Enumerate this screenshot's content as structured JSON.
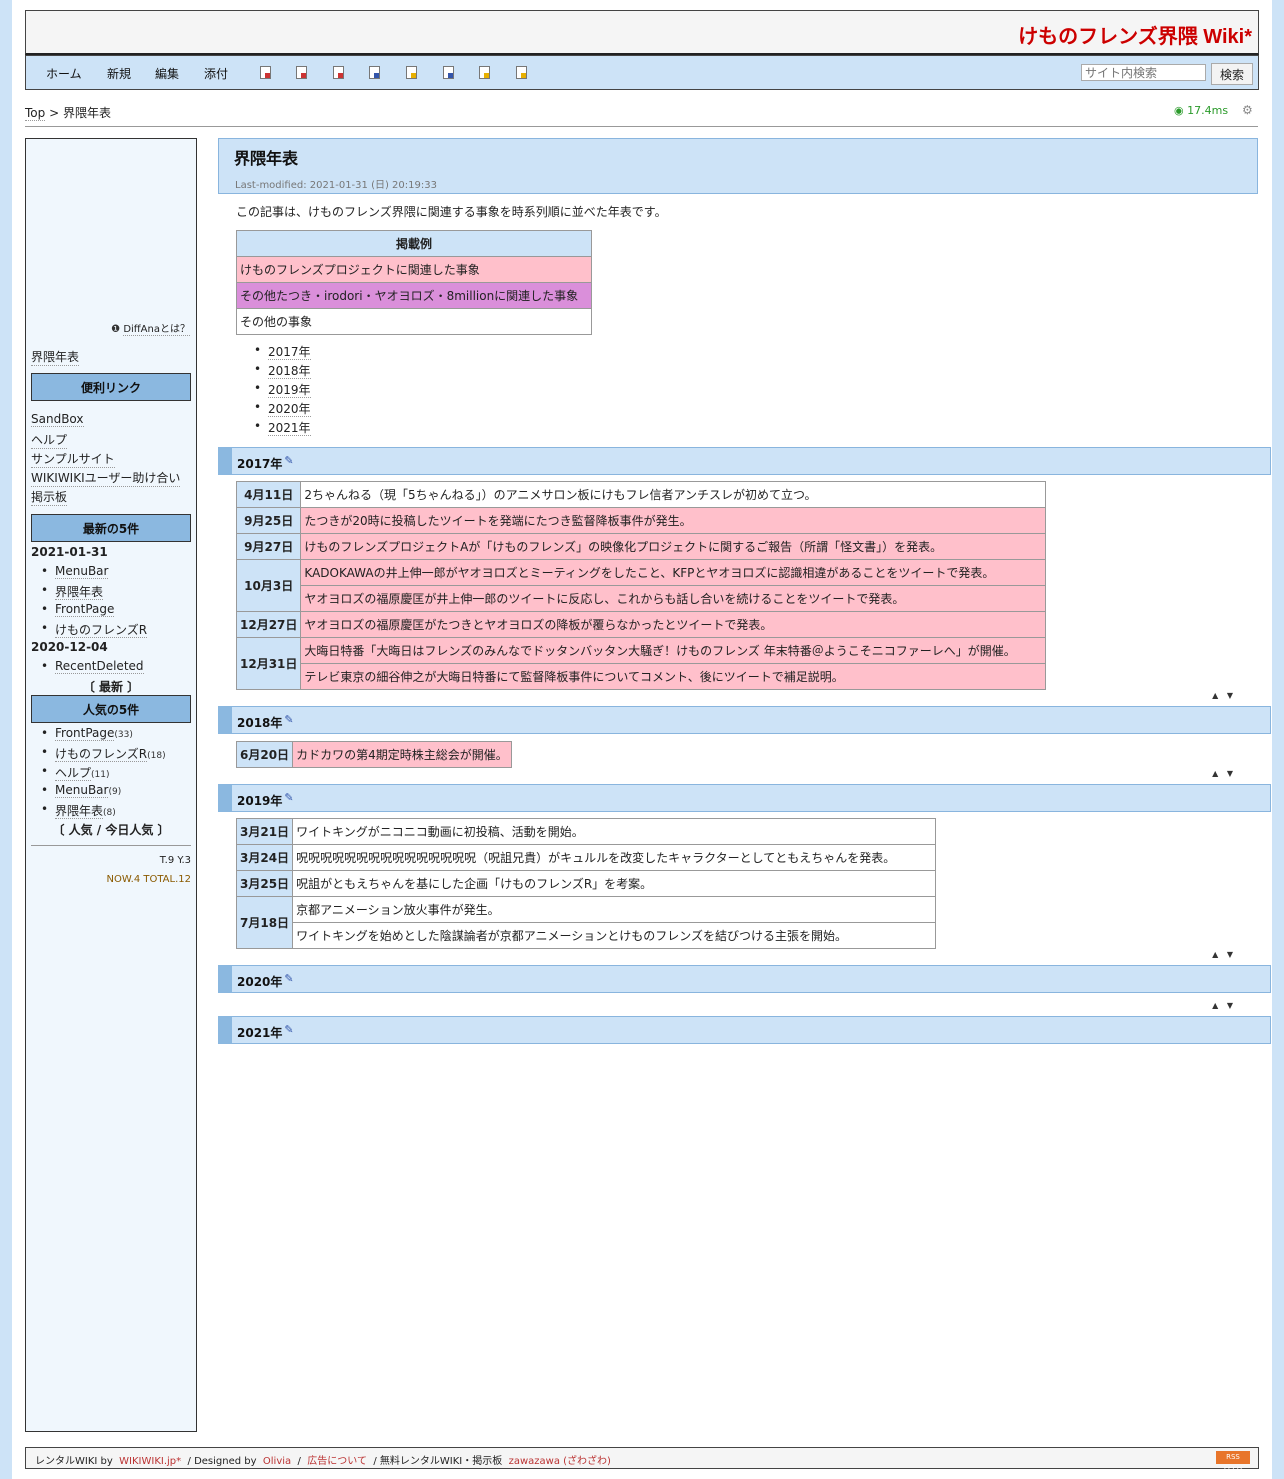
{
  "header": {
    "site_title": "けものフレンズ界隈 Wiki*"
  },
  "nav": {
    "items": [
      "ホーム",
      "新規",
      "編集",
      "添付"
    ],
    "search_placeholder": "サイト内検索",
    "search_button": "検索"
  },
  "breadcrumb": {
    "top": "Top",
    "sep": ">",
    "current": "界隈年表"
  },
  "timing": "17.4ms",
  "sidebar": {
    "diffana": "DiffAnaとは？",
    "page_link": "界隈年表",
    "useful_links_title": "便利リンク",
    "useful_links": [
      "SandBox",
      "ヘルプ",
      "サンプルサイト",
      "WIKIWIKIユーザー助け合い",
      "掲示板"
    ],
    "recent_title": "最新の5件",
    "recent_groups": [
      {
        "date": "2021-01-31",
        "items": [
          "MenuBar",
          "界隈年表",
          "FrontPage",
          "けものフレンズR"
        ]
      },
      {
        "date": "2020-12-04",
        "items": [
          "RecentDeleted"
        ]
      }
    ],
    "recent_more": "〔 最新 〕",
    "popular_title": "人気の5件",
    "popular": [
      {
        "name": "FrontPage",
        "count": "(33)"
      },
      {
        "name": "けものフレンズR",
        "count": "(18)"
      },
      {
        "name": "ヘルプ",
        "count": "(11)"
      },
      {
        "name": "MenuBar",
        "count": "(9)"
      },
      {
        "name": "界隈年表",
        "count": "(8)"
      }
    ],
    "popular_more": "〔 人気 / 今日人気 〕",
    "counter_ty": "T.9 Y.3",
    "counter_now": "NOW.4 TOTAL.12"
  },
  "page": {
    "title": "界隈年表",
    "last_modified": "Last-modified: 2021-01-31 (日) 20:19:33",
    "intro": "この記事は、けものフレンズ界隈に関連する事象を時系列順に並べた年表です。",
    "legend": {
      "header": "掲載例",
      "rows": [
        "けものフレンズプロジェクトに関連した事象",
        "その他たつき・irodori・ヤオヨロズ・8millionに関連した事象",
        "その他の事象"
      ]
    },
    "toc": [
      "2017年",
      "2018年",
      "2019年",
      "2020年",
      "2021年"
    ],
    "sections": {
      "y2017": {
        "title": "2017年",
        "rows": [
          [
            "4月11日",
            "2ちゃんねる（現「5ちゃんねる」）のアニメサロン板にけもフレ信者アンチスレが初めて立つ。"
          ],
          [
            "9月25日",
            "たつきが20時に投稿したツイートを発端にたつき監督降板事件が発生。"
          ],
          [
            "9月27日",
            "けものフレンズプロジェクトAが「けものフレンズ」の映像化プロジェクトに関するご報告（所謂「怪文書」）を発表。"
          ],
          [
            "10月3日",
            "KADOKAWAの井上伸一郎がヤオヨロズとミーティングをしたこと、KFPとヤオヨロズに認識相違があることをツイートで発表。"
          ],
          [
            "",
            "ヤオヨロズの福原慶匡が井上伸一郎のツイートに反応し、これからも話し合いを続けることをツイートで発表。"
          ],
          [
            "12月27日",
            "ヤオヨロズの福原慶匡がたつきとヤオヨロズの降板が覆らなかったとツイートで発表。"
          ],
          [
            "12月31日",
            "大晦日特番「大晦日はフレンズのみんなでドッタンバッタン大騒ぎ！けものフレンズ 年末特番＠ようこそニコファーレへ」が開催。"
          ],
          [
            "",
            "テレビ東京の細谷伸之が大晦日特番にて監督降板事件についてコメント、後にツイートで補足説明。"
          ]
        ]
      },
      "y2018": {
        "title": "2018年",
        "rows": [
          [
            "6月20日",
            "カドカワの第4期定時株主総会が開催。"
          ]
        ]
      },
      "y2019": {
        "title": "2019年",
        "rows": [
          [
            "3月21日",
            "ワイトキングがニコニコ動画に初投稿、活動を開始。"
          ],
          [
            "3月24日",
            "呪呪呪呪呪呪呪呪呪呪呪呪呪呪呪（呪詛兄貴）がキュルルを改変したキャラクターとしてともえちゃんを発表。"
          ],
          [
            "3月25日",
            "呪詛がともえちゃんを基にした企画「けものフレンズR」を考案。"
          ],
          [
            "7月18日",
            "京都アニメーション放火事件が発生。"
          ],
          [
            "",
            "ワイトキングを始めとした陰謀論者が京都アニメーションとけものフレンズを結びつける主張を開始。"
          ]
        ]
      },
      "y2020": {
        "title": "2020年"
      },
      "y2021": {
        "title": "2021年"
      }
    },
    "arrows": "▲ ▼"
  },
  "footer": {
    "rental": "レンタルWIKI by",
    "wikiwiki": "WIKIWIKI.jp*",
    "designed": "/ Designed by",
    "olivia": "Olivia",
    "slash": "/",
    "ad": "広告について",
    "free": "/ 無料レンタルWIKI・掲示板",
    "zawazawa": "zawazawa (ざわざわ)",
    "rss": "RSS FEED"
  },
  "colors": {
    "site_title": "#cc0000",
    "pink_row": "#ffc0cb",
    "violet_row": "#da8fda",
    "accent_blue": "#cde3f7"
  }
}
